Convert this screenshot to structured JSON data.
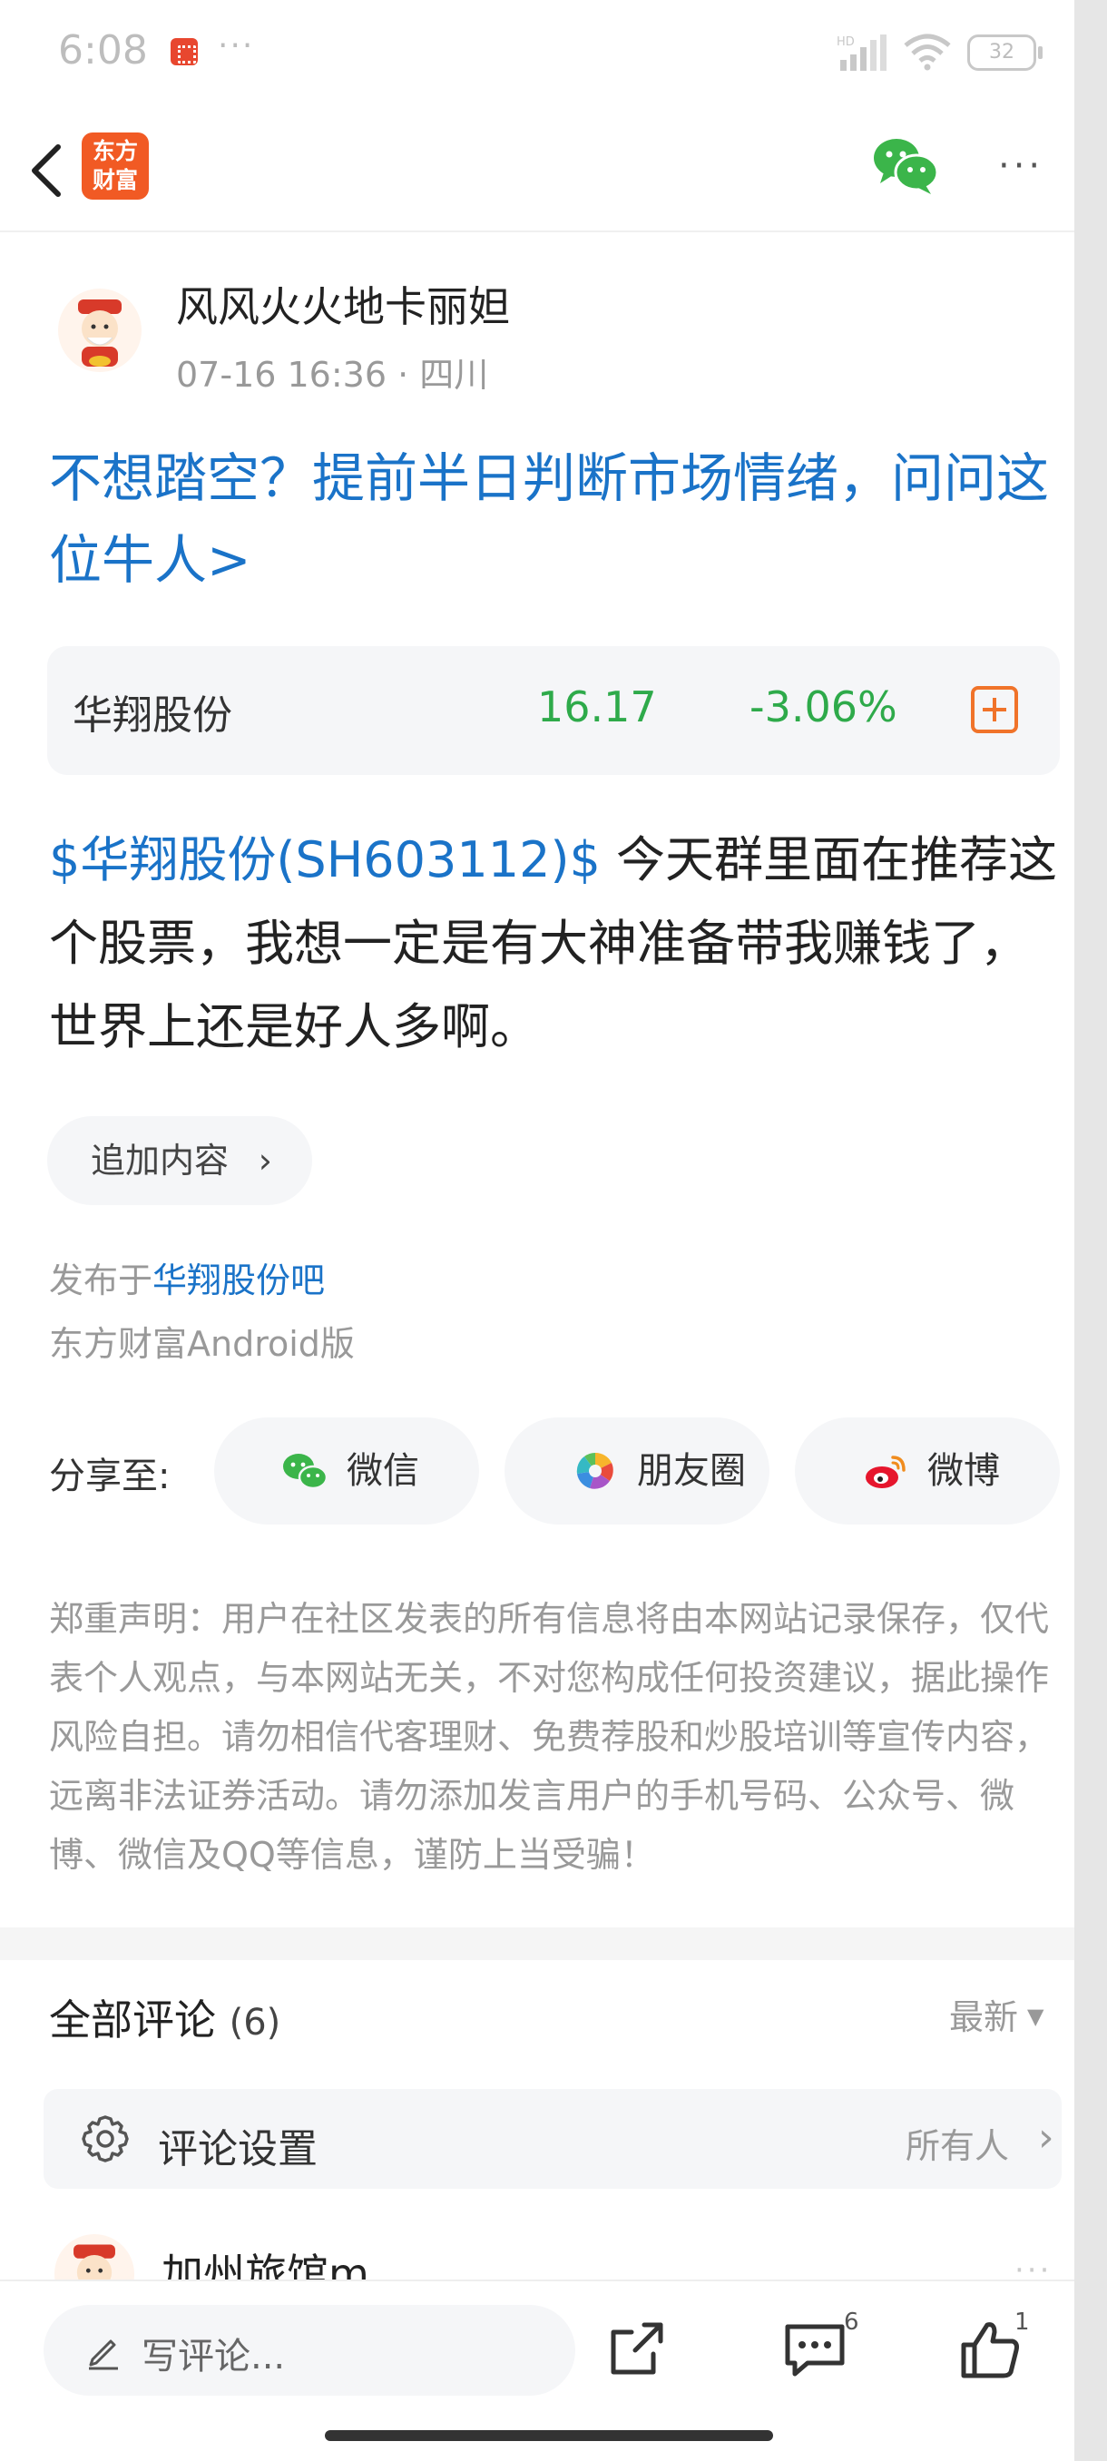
{
  "status_bar": {
    "time": "6:08",
    "more": "···",
    "battery": "32"
  },
  "nav": {
    "logo_line1": "东方",
    "logo_line2": "财富",
    "more": "···"
  },
  "post": {
    "author": "风风火火地卡丽妲",
    "meta": "07-16 16:36 · 四川",
    "title": "不想踏空？提前半日判断市场情绪，问问这位牛人>",
    "stock": {
      "name": "华翔股份",
      "price": "16.17",
      "change": "-3.06%",
      "change_color": "#2eaa4a"
    },
    "body_link": "$华翔股份(SH603112)$",
    "body_text": " 今天群里面在推荐这个股票，我想一定是有大神准备带我赚钱了，世界上还是好人多啊。",
    "append_label": "追加内容",
    "published_prefix": "发布于",
    "published_bar": "华翔股份吧",
    "client": "东方财富Android版"
  },
  "share": {
    "label": "分享至:",
    "wechat": "微信",
    "moments": "朋友圈",
    "weibo": "微博"
  },
  "disclaimer": "郑重声明：用户在社区发表的所有信息将由本网站记录保存，仅代表个人观点，与本网站无关，不对您构成任何投资建议，据此操作风险自担。请勿相信代客理财、免费荐股和炒股培训等宣传内容，远离非法证券活动。请勿添加发言用户的手机号码、公众号、微博、微信及QQ等信息，谨防上当受骗！",
  "comments": {
    "title": "全部评论",
    "count": "(6)",
    "sort": "最新",
    "settings_label": "评论设置",
    "settings_value": "所有人",
    "first_author": "加州旅馆m",
    "more": "···"
  },
  "bottom_bar": {
    "write_placeholder": "写评论...",
    "comment_count": "6",
    "like_count": "1"
  },
  "colors": {
    "link": "#1a73c8",
    "down": "#2eaa4a",
    "accent": "#f0732a",
    "brand": "#f15a24"
  }
}
